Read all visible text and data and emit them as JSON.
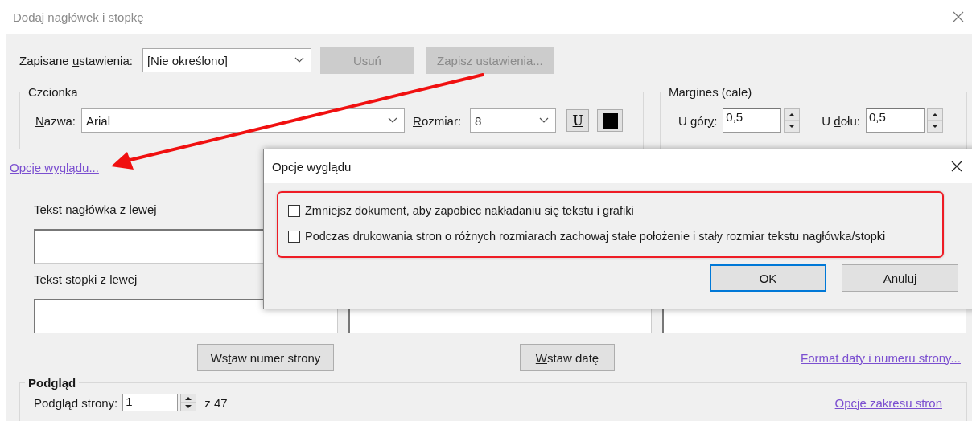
{
  "window": {
    "title": "Dodaj nagłówek i stopkę"
  },
  "saved_settings": {
    "label": {
      "pre": "Zapisane ",
      "key": "u",
      "post": "stawienia:"
    },
    "value": "[Nie określono]",
    "buttons": [
      {
        "label": "Usuń",
        "disabled": true
      },
      {
        "label": "Zapisz ustawienia...",
        "disabled": true
      }
    ]
  },
  "font": {
    "title": "Czcionka",
    "name_label": {
      "key": "N",
      "post": "azwa:"
    },
    "name_value": "Arial",
    "size_label": {
      "key": "R",
      "post": "ozmiar:"
    },
    "size_value": "8",
    "underline_button": "U"
  },
  "margins": {
    "title": "Margines (cale)",
    "fields": [
      {
        "label": {
          "pre": "U gór",
          "key": "y",
          "post": ":"
        },
        "value": "0,5"
      },
      {
        "label": {
          "pre": "U ",
          "key": "d",
          "post": "ołu:"
        },
        "value": "0,5"
      }
    ]
  },
  "appearance_link": "Opcje wyglądu...",
  "header_label": "Tekst nagłówka z lewej",
  "footer_label": "Tekst stopki z lewej",
  "insert_buttons": [
    {
      "label": {
        "pre": "Ws",
        "key": "t",
        "post": "aw numer strony"
      }
    },
    {
      "label": {
        "key": "W",
        "post": "staw datę"
      }
    }
  ],
  "format_link": "Format daty i numeru strony...",
  "preview": {
    "title": "Podgląd",
    "page_label": "Podgląd strony:",
    "page_value": "1",
    "page_count": "z 47",
    "range_link": "Opcje zakresu stron"
  },
  "dialog": {
    "title": "Opcje wyglądu",
    "options": [
      {
        "label": "Zmniejsz dokument, aby zapobiec nakładaniu się tekstu i grafiki",
        "checked": false
      },
      {
        "label": "Podczas drukowania stron o różnych rozmiarach zachowaj stałe położenie i stały rozmiar tekstu nagłówka/stopki",
        "checked": false
      }
    ],
    "buttons": [
      {
        "label": "OK",
        "default": true
      },
      {
        "label": "Anuluj",
        "default": false
      }
    ]
  }
}
